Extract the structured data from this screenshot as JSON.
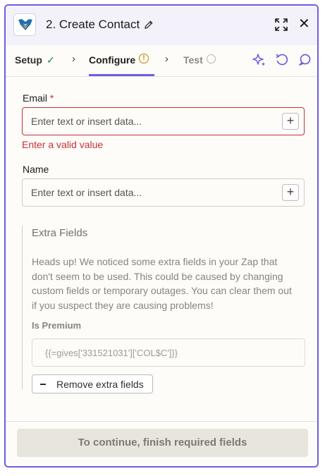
{
  "header": {
    "title": "2. Create Contact",
    "app_icon": "getresponse-fox-icon",
    "actions": [
      "pencil-icon",
      "expand-icon",
      "close-icon"
    ]
  },
  "tabs": [
    {
      "label": "Setup",
      "status": "complete"
    },
    {
      "label": "Configure",
      "status": "warning",
      "active": true
    },
    {
      "label": "Test",
      "status": "pending"
    }
  ],
  "toolbar_icons": [
    "ai-sparkle-icon",
    "refresh-icon",
    "comment-icon"
  ],
  "form": {
    "email": {
      "label": "Email",
      "required_mark": "*",
      "placeholder": "Enter text or insert data...",
      "error": "Enter a valid value"
    },
    "name": {
      "label": "Name",
      "placeholder": "Enter text or insert data..."
    }
  },
  "extra_fields": {
    "title": "Extra Fields",
    "description": "Heads up! We noticed some extra fields in your Zap that don't seem to be used. This could be caused by changing custom fields or temporary outages. You can clear them out if you suspect they are causing problems!",
    "field_label": "Is Premium",
    "field_value": "{{=gives['331521031']['COL$C']}}",
    "remove_button": "Remove extra fields"
  },
  "footer": {
    "button": "To continue, finish required fields"
  },
  "colors": {
    "accent": "#6d5fe0",
    "error": "#c5323b",
    "success": "#1f8d4e",
    "warning": "#b88600"
  }
}
